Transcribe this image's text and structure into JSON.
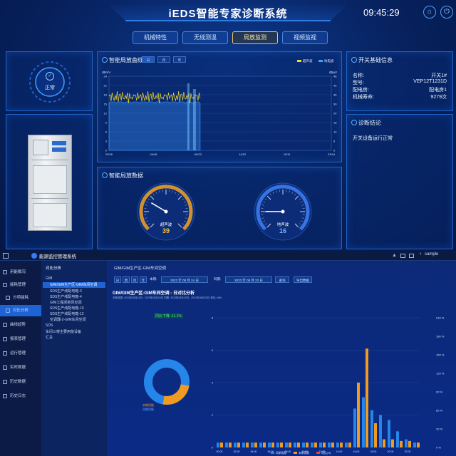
{
  "header": {
    "title": "iEDS智能专家诊断系统",
    "clock": "09:45:29",
    "home_icon": "home-icon",
    "power_icon": "power-icon"
  },
  "tabs": [
    {
      "label": "机械特性",
      "active": false
    },
    {
      "label": "无线测温",
      "active": false
    },
    {
      "label": "局放监测",
      "active": true
    },
    {
      "label": "视频监视",
      "active": false
    }
  ],
  "status": {
    "label": "正常",
    "icon": "check-circle-icon"
  },
  "curve_panel": {
    "title": "智能局放曲线",
    "range_tabs": [
      "日",
      "月",
      "年"
    ],
    "legend": [
      "超声波",
      "地电波"
    ],
    "y_left_unit": "dBmV",
    "y_right_unit": "dBμV",
    "y_left_ticks": [
      "24",
      "21",
      "18",
      "15",
      "12",
      "9",
      "6",
      "3",
      "0"
    ],
    "y_right_ticks": [
      "48",
      "42",
      "36",
      "30",
      "24",
      "18",
      "12",
      "6",
      "0"
    ],
    "x_ticks": [
      "23/26",
      "04/45",
      "09/23",
      "14/22",
      "19/11",
      "23/44"
    ]
  },
  "data_panel": {
    "title": "智能局放数据",
    "gauges": [
      {
        "label": "超声波",
        "value": "39",
        "fraction": 0.55,
        "color": "#f0a020"
      },
      {
        "label": "地声波",
        "value": "16",
        "fraction": 0.3,
        "color": "#3a7cf5"
      }
    ]
  },
  "info_panel": {
    "title": "开关基础信息",
    "rows": [
      {
        "k": "名称:",
        "v": "开关1#"
      },
      {
        "k": "型号:",
        "v": "VEP12T1231D"
      },
      {
        "k": "配电房:",
        "v": "配电房1"
      },
      {
        "k": "机械寿命:",
        "v": "9279次"
      }
    ]
  },
  "diag_panel": {
    "title": "诊断结论",
    "text": "开关设备运行正常"
  },
  "bottom": {
    "app_title": "能源监控管理系统",
    "user": "sample",
    "breadcrumb": "对比分析",
    "side_items": [
      "用能概况",
      "能耗管理",
      "分项能耗",
      "对比分析",
      "曲线趋势",
      "报表管理",
      "运行管理",
      "实时数据",
      "历史数据",
      "历史日志"
    ],
    "tree_items": [
      "GIM",
      "GIM/GIM生产区-GIM车间空调",
      "SDS生产线配电箱-3",
      "SDS生产线配电箱-4",
      "GIM工程间新风空调",
      "SDS生产线配电箱-10",
      "SDS生产线配电箱-12",
      "空调器-2-GIM车间空调",
      "SDS",
      "车间三楼主要用能设备",
      "汇总"
    ],
    "content_tab": "GIM/GIM生产区-GIM车间空调",
    "toolbar": {
      "labels": [
        "日",
        "周",
        "月",
        "年",
        "本期:"
      ],
      "date1": "2023 年 08 月 24 日",
      "compare_label": "同期:",
      "date2": "2023 年 08 月 23 日",
      "query": "查询",
      "export": "导出数据"
    },
    "chart_title": "GIM/GIM生产区-GIM车间空调 - 日对比分析",
    "chart_subtitle": "本期范围: 2023年08月24日 - 2023年08月24日  同期: 2023年08月23日 - 2023年08月23日  单位: kWh",
    "badge": "同比下降 -11.1%",
    "right_ticks": [
      "210 %",
      "180 %",
      "150 %",
      "120 %",
      "90 %",
      "60 %",
      "30 %",
      "0 %"
    ],
    "left_ticks": [
      "8",
      "6",
      "4",
      "2",
      "0"
    ],
    "donut_labels": [
      "本期用能",
      "同期用能"
    ],
    "legend": [
      "同期用能",
      "本期用能",
      "同比(%)"
    ]
  },
  "chart_data": {
    "type": "bar",
    "categories": [
      "00:00",
      "01:00",
      "02:00",
      "03:00",
      "04:00",
      "05:00",
      "06:00",
      "07:00",
      "08:00",
      "09:00",
      "10:00",
      "11:00",
      "12:00",
      "13:00",
      "14:00",
      "15:00",
      "16:00",
      "17:00",
      "18:00",
      "19:00",
      "20:00",
      "21:00",
      "22:00",
      "23:00"
    ],
    "series": [
      {
        "name": "同期用能",
        "values": [
          0.3,
          0.3,
          0.3,
          0.3,
          0.3,
          0.3,
          0.3,
          0.3,
          0.3,
          0.3,
          0.3,
          0.3,
          0.3,
          0.3,
          0.3,
          0.3,
          2.4,
          3.1,
          2.3,
          2.0,
          1.7,
          1.0,
          0.5,
          0.3
        ]
      },
      {
        "name": "本期用能",
        "values": [
          0.3,
          0.3,
          0.3,
          0.3,
          0.3,
          0.3,
          0.3,
          0.3,
          0.3,
          0.3,
          0.3,
          0.3,
          0.3,
          0.3,
          0.3,
          0.3,
          4.0,
          6.1,
          1.5,
          0.5,
          0.5,
          0.4,
          0.4,
          0.3
        ]
      }
    ],
    "ylim": [
      0,
      8
    ]
  }
}
